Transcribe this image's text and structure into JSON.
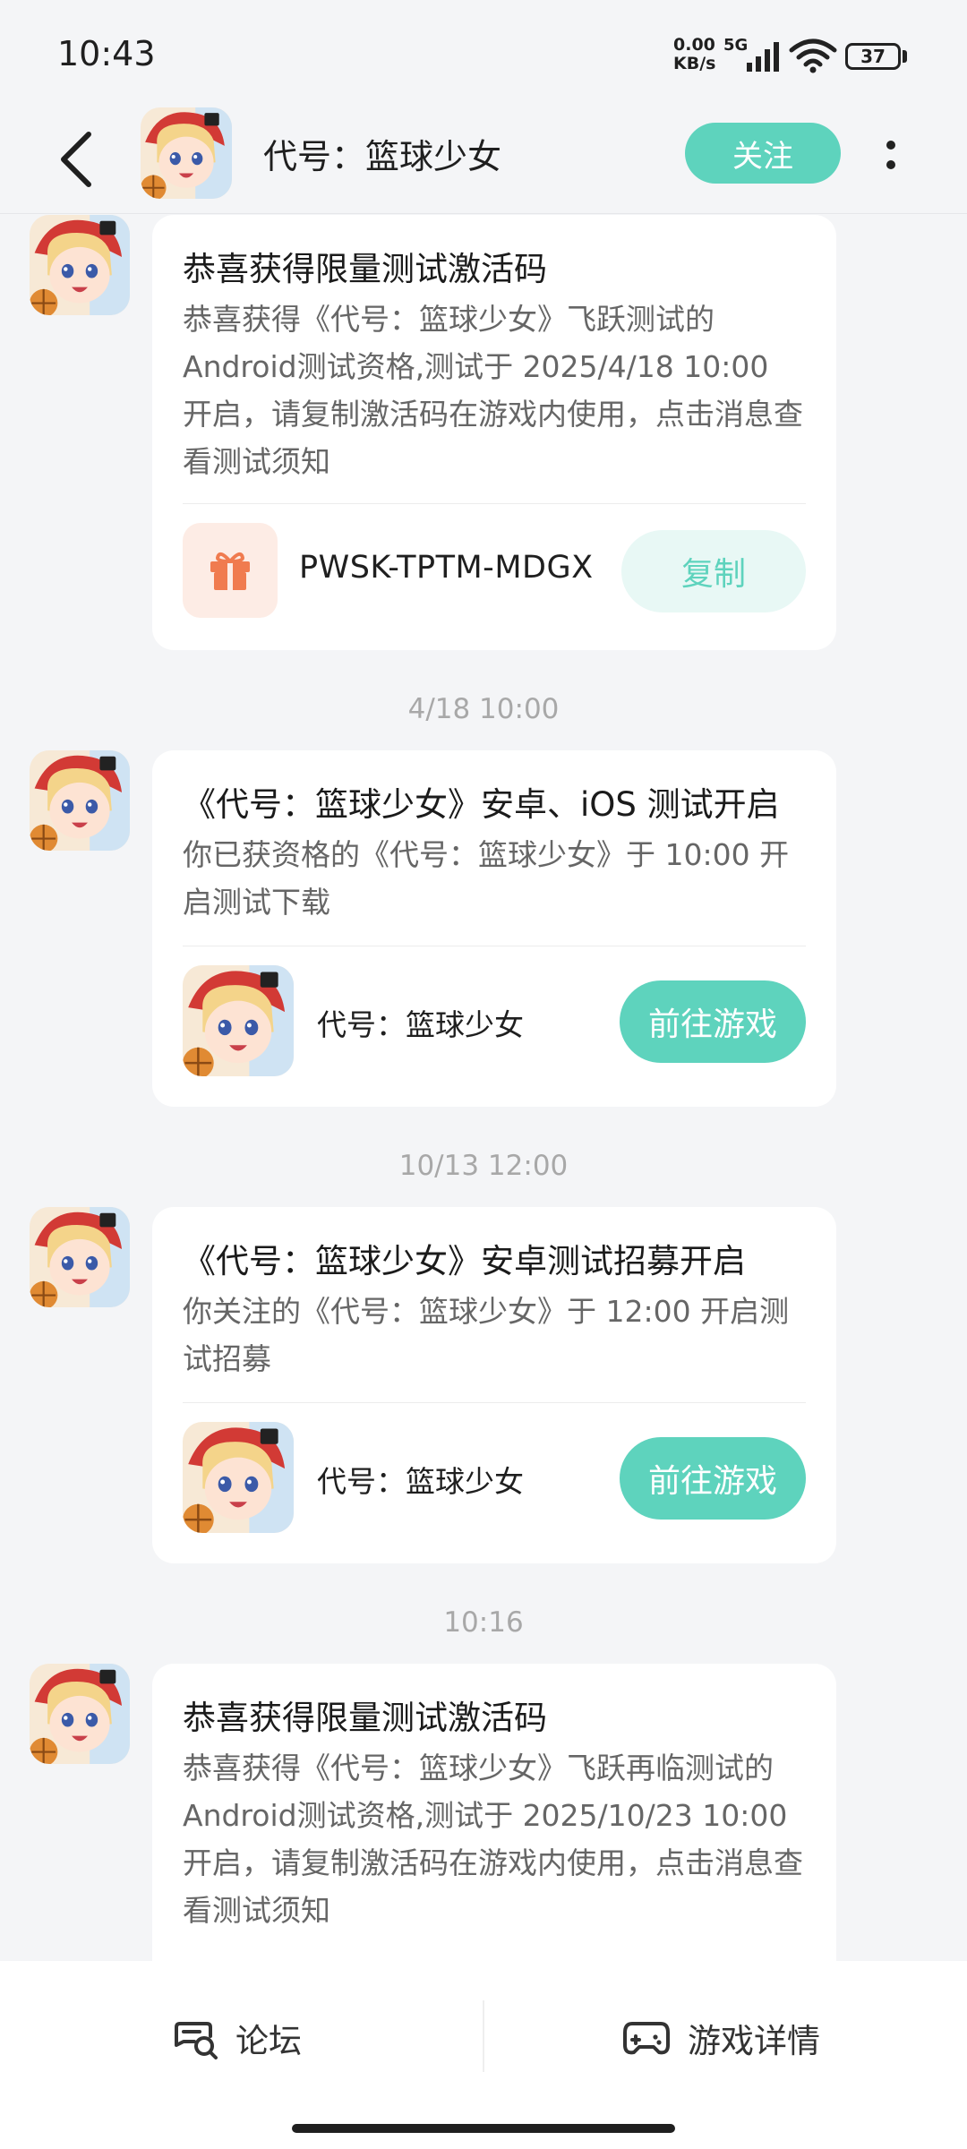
{
  "status_bar": {
    "time": "10:43",
    "net_speed_value": "0.00",
    "net_speed_unit": "KB/s",
    "network": "5G",
    "battery": "37"
  },
  "header": {
    "title": "代号：篮球少女",
    "follow_label": "关注"
  },
  "messages": [
    {
      "title": "恭喜获得限量测试激活码",
      "body": "恭喜获得《代号：篮球少女》飞跃测试的Android测试资格,测试于 2025/4/18 10:00 开启，请复制激活码在游戏内使用，点击消息查看测试须知",
      "code": "PWSK-TPTM-MDGX",
      "copy_label": "复制"
    },
    {
      "timestamp": "4/18  10:00",
      "title": "《代号：篮球少女》安卓、iOS 测试开启",
      "body": "你已获资格的《代号：篮球少女》于 10:00 开启测试下载",
      "game_name": "代号：篮球少女",
      "action_label": "前往游戏"
    },
    {
      "timestamp": "10/13  12:00",
      "title": "《代号：篮球少女》安卓测试招募开启",
      "body": "你关注的《代号：篮球少女》于 12:00 开启测试招募",
      "game_name": "代号：篮球少女",
      "action_label": "前往游戏"
    },
    {
      "timestamp": "10:16",
      "title": "恭喜获得限量测试激活码",
      "body": "恭喜获得《代号：篮球少女》飞跃再临测试的Android测试资格,测试于 2025/10/23 10:00 开启，请复制激活码在游戏内使用，点击消息查看测试须知"
    }
  ],
  "bottom_bar": {
    "forum_label": "论坛",
    "detail_label": "游戏详情"
  },
  "colors": {
    "accent": "#5ed3bd",
    "accent_light": "#e8f8f5",
    "gift_bg": "#fdece5",
    "gift_icon": "#f07b4f"
  },
  "icons": [
    "back-arrow-icon",
    "more-vert-icon",
    "gift-icon",
    "forum-chat-icon",
    "gamepad-icon"
  ]
}
